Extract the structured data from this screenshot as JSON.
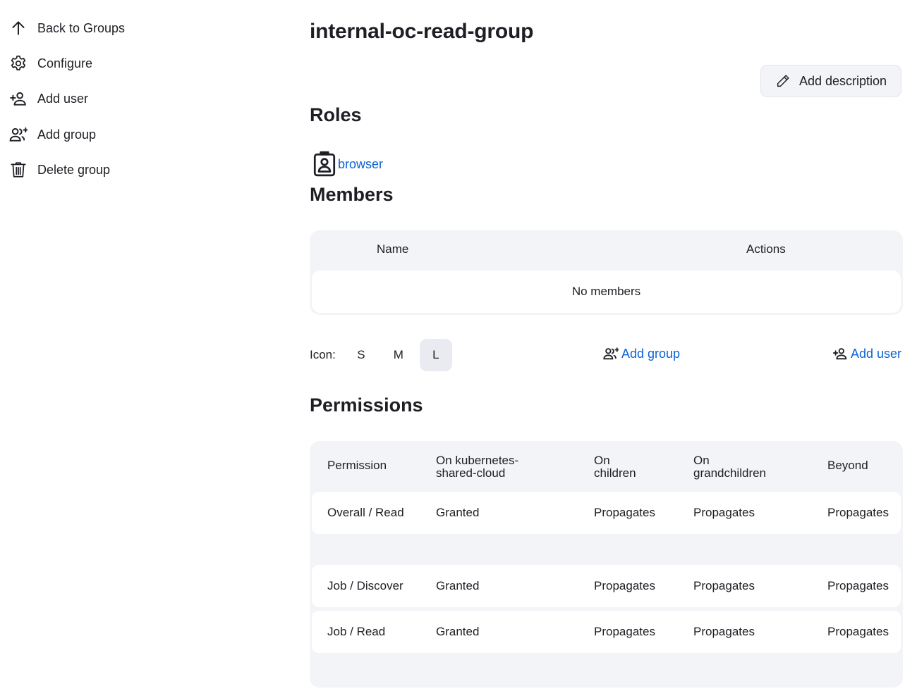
{
  "sidebar": {
    "items": [
      {
        "label": "Back to Groups",
        "icon": "arrow-up-icon"
      },
      {
        "label": "Configure",
        "icon": "gear-icon"
      },
      {
        "label": "Add user",
        "icon": "add-user-icon"
      },
      {
        "label": "Add group",
        "icon": "add-group-icon"
      },
      {
        "label": "Delete group",
        "icon": "trash-icon"
      }
    ]
  },
  "page": {
    "title": "internal-oc-read-group",
    "add_description_label": "Add description"
  },
  "roles": {
    "heading": "Roles",
    "items": [
      {
        "label": "browser",
        "icon": "badge-icon"
      }
    ]
  },
  "members": {
    "heading": "Members",
    "columns": [
      "Name",
      "Actions"
    ],
    "empty_text": "No members"
  },
  "icon_size": {
    "label": "Icon:",
    "options": [
      "S",
      "M",
      "L"
    ],
    "selected": "L"
  },
  "actions": {
    "add_group_label": "Add group",
    "add_user_label": "Add user"
  },
  "permissions": {
    "heading": "Permissions",
    "columns": [
      "Permission",
      "On kubernetes-\nshared-cloud",
      "On\nchildren",
      "On\ngrandchildren",
      "Beyond"
    ],
    "rows": [
      [
        "Overall / Read",
        "Granted",
        "Propagates",
        "Propagates",
        "Propagates"
      ],
      [
        "Job / Discover",
        "Granted",
        "Propagates",
        "Propagates",
        "Propagates"
      ],
      [
        "Job / Read",
        "Granted",
        "Propagates",
        "Propagates",
        "Propagates"
      ]
    ]
  },
  "colors": {
    "link": "#0a62d6",
    "panel_bg": "#f3f4f7",
    "text": "#1d1f24"
  }
}
